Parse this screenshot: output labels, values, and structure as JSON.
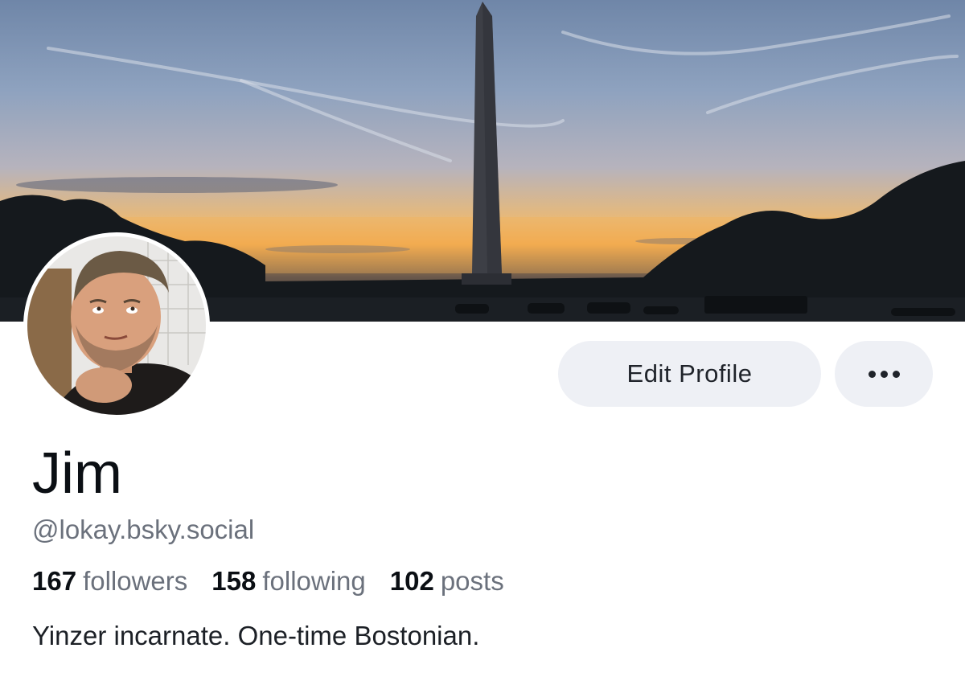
{
  "profile": {
    "name": "Jim",
    "handle": "@lokay.bsky.social",
    "bio": "Yinzer incarnate. One-time Bostonian.",
    "stats": {
      "followers_count": "167",
      "followers_label": "followers",
      "following_count": "158",
      "following_label": "following",
      "posts_count": "102",
      "posts_label": "posts"
    }
  },
  "actions": {
    "edit_label": "Edit Profile",
    "more_icon": "ellipsis-icon"
  },
  "colors": {
    "button_bg": "#eef0f5",
    "text_primary": "#0b0f14",
    "text_secondary": "#6b717c"
  }
}
